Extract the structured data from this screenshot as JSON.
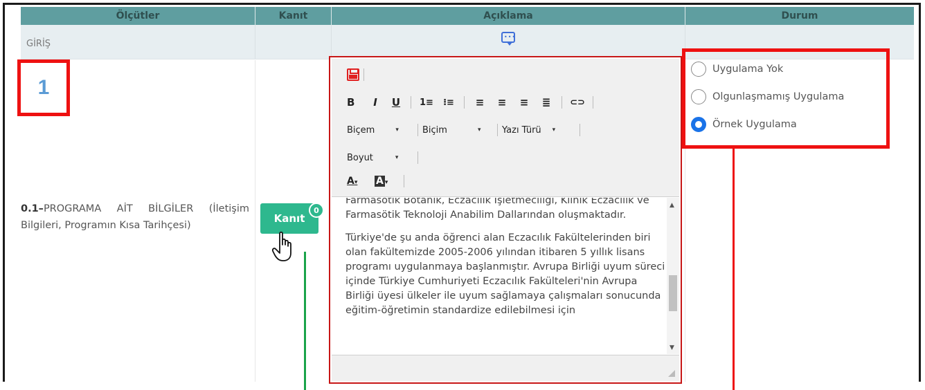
{
  "header": {
    "col_criteria": "Ölçütler",
    "col_evidence": "Kanıt",
    "col_description": "Açıklama",
    "col_status": "Durum"
  },
  "section": {
    "label": "GİRİŞ"
  },
  "annotation": {
    "number": "1"
  },
  "criterion": {
    "code": "0.1–",
    "text": "PROGRAMA AİT BİLGİLER (İletişim Bilgileri, Programın Kısa Tarihçesi)"
  },
  "evidence": {
    "button_label": "Kanıt",
    "count": "0"
  },
  "editor": {
    "toolbar": {
      "style_label": "Biçem",
      "format_label": "Biçim",
      "font_label": "Yazı Türü",
      "size_label": "Boyut",
      "bold": "B",
      "italic": "I",
      "underline": "U"
    },
    "paragraphs": [
      "Farmasötik Botanik, Eczacılık İşletmeciliği, Klinik Eczacılık ve Farmasötik Teknoloji Anabilim Dallarından oluşmaktadır.",
      "Türkiye'de şu anda öğrenci alan Eczacılık Fakültelerinden biri olan fakültemizde 2005-2006 yılından itibaren 5 yıllık lisans programı uygulanmaya başlanmıştır. Avrupa Birliği uyum süreci içinde Türkiye Cumhuriyeti Eczacılık Fakülteleri'nin Avrupa Birliği üyesi ülkeler ile uyum sağlamaya çalışmaları sonucunda eğitim-öğretimin standardize edilebilmesi için"
    ]
  },
  "status": {
    "options": [
      {
        "label": "Uygulama Yok",
        "checked": false
      },
      {
        "label": "Olgunlaşmamış Uygulama",
        "checked": false
      },
      {
        "label": "Örnek Uygulama",
        "checked": true
      }
    ]
  },
  "colors": {
    "header_bg": "#5f9ea0",
    "accent_green": "#2eb88e",
    "annotation_red": "#ee1111",
    "radio_blue": "#1a73e8"
  }
}
